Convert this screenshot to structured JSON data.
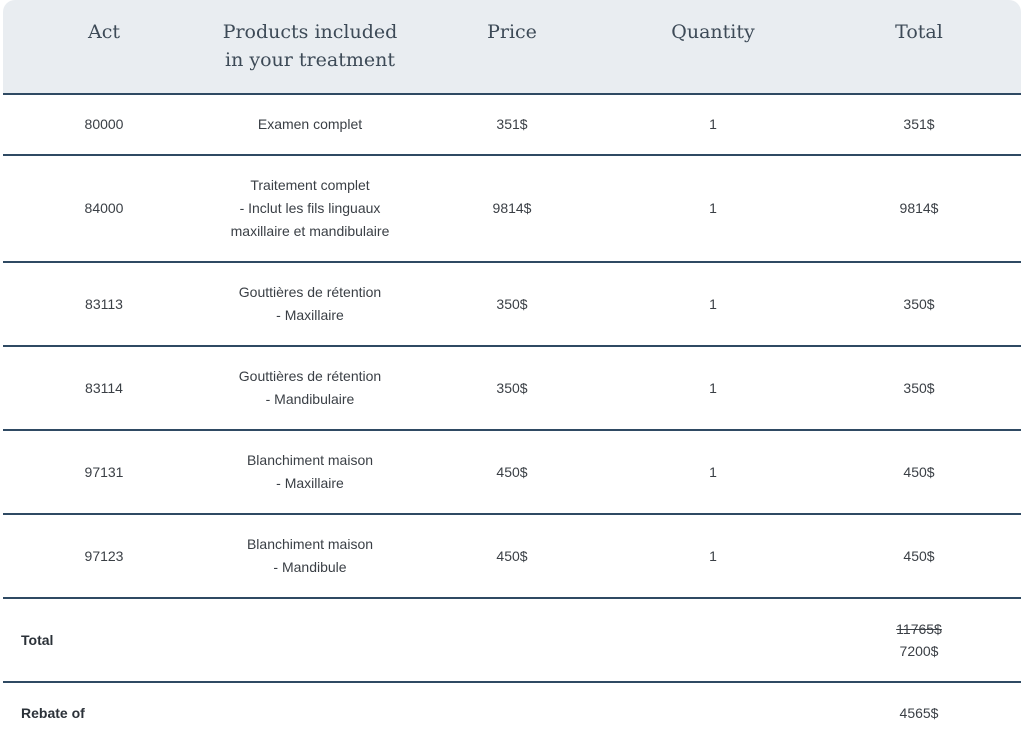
{
  "header": {
    "act": "Act",
    "products_line1": "Products included",
    "products_line2": "in your treatment",
    "price": "Price",
    "quantity": "Quantity",
    "total": "Total"
  },
  "rows": [
    {
      "act": "80000",
      "product_lines": [
        "Examen complet"
      ],
      "price": "351$",
      "quantity": "1",
      "total": "351$"
    },
    {
      "act": "84000",
      "product_lines": [
        "Traitement complet",
        "- Inclut les fils linguaux",
        "maxillaire et mandibulaire"
      ],
      "price": "9814$",
      "quantity": "1",
      "total": "9814$"
    },
    {
      "act": "83113",
      "product_lines": [
        "Gouttières de rétention",
        "- Maxillaire"
      ],
      "price": "350$",
      "quantity": "1",
      "total": "350$"
    },
    {
      "act": "83114",
      "product_lines": [
        "Gouttières de rétention",
        "- Mandibulaire"
      ],
      "price": "350$",
      "quantity": "1",
      "total": "350$"
    },
    {
      "act": "97131",
      "product_lines": [
        "Blanchiment maison",
        "- Maxillaire"
      ],
      "price": "450$",
      "quantity": "1",
      "total": "450$"
    },
    {
      "act": "97123",
      "product_lines": [
        "Blanchiment maison",
        "- Mandibule"
      ],
      "price": "450$",
      "quantity": "1",
      "total": "450$"
    }
  ],
  "summary": {
    "total_label": "Total",
    "original_total": "11765$",
    "discounted_total": "7200$",
    "rebate_label": "Rebate of",
    "rebate_value": "4565$"
  }
}
